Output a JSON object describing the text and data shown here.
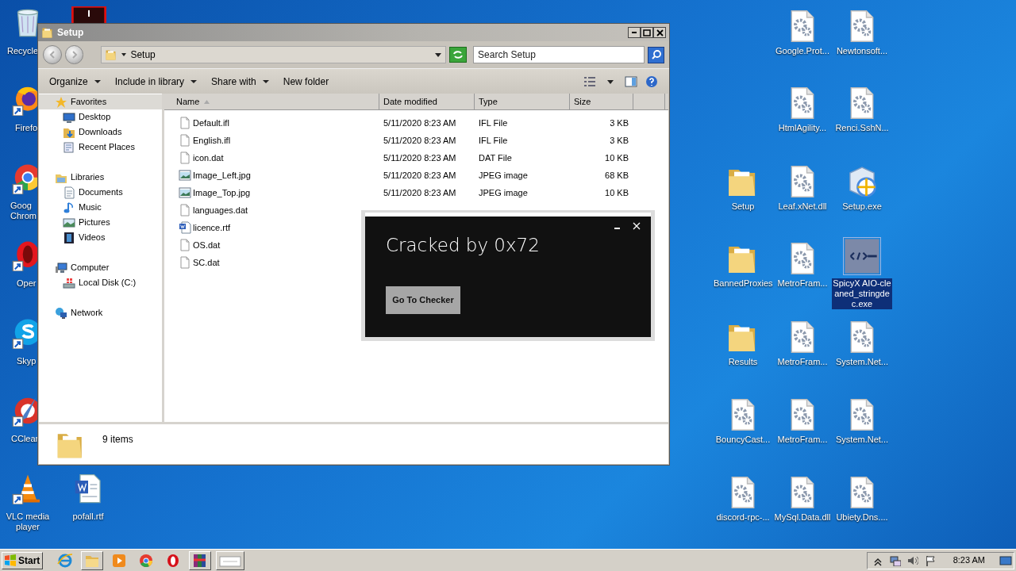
{
  "desktop_left": [
    {
      "kind": "recycle",
      "label": "Recycle"
    },
    {
      "kind": "redapp"
    },
    {
      "kind": "firefox",
      "label": "Firefo"
    },
    {
      "kind": "chrome",
      "label": "Goog Chrom"
    },
    {
      "kind": "opera",
      "label": "Oper"
    },
    {
      "kind": "skype",
      "label": "Skyp"
    },
    {
      "kind": "ccleaner",
      "label": "CClear"
    },
    {
      "kind": "vlc",
      "label": "VLC media player"
    },
    {
      "kind": "word",
      "label": "pofall.rtf"
    }
  ],
  "explorer": {
    "title": "Setup",
    "address": "Setup",
    "search": {
      "placeholder": "Search Setup"
    },
    "toolbar": [
      {
        "label": "Organize",
        "dropdown": true
      },
      {
        "label": "Include in library",
        "dropdown": true
      },
      {
        "label": "Share with",
        "dropdown": true
      },
      {
        "label": "New folder",
        "dropdown": false
      }
    ],
    "navigation": [
      {
        "label": "Favorites",
        "kind": "star",
        "selected": true,
        "children": [
          {
            "label": "Desktop",
            "kind": "desktop",
            "selected": false
          },
          {
            "label": "Downloads",
            "kind": "downloads",
            "selected": false
          },
          {
            "label": "Recent Places",
            "kind": "recent",
            "selected": false
          }
        ]
      },
      {
        "label": "Libraries",
        "kind": "library",
        "selected": false,
        "children": [
          {
            "label": "Documents",
            "kind": "document",
            "selected": false
          },
          {
            "label": "Music",
            "kind": "music",
            "selected": false
          },
          {
            "label": "Pictures",
            "kind": "pictures",
            "selected": false
          },
          {
            "label": "Videos",
            "kind": "videos",
            "selected": false
          }
        ]
      },
      {
        "label": "Computer",
        "kind": "computer",
        "selected": false,
        "children": [
          {
            "label": "Local Disk (C:)",
            "kind": "disk",
            "selected": false
          }
        ]
      },
      {
        "label": "Network",
        "kind": "network",
        "selected": false
      }
    ],
    "columns": [
      {
        "label": "Name",
        "sorted": true
      },
      {
        "label": "Date modified",
        "sorted": false
      },
      {
        "label": "Type",
        "sorted": false
      },
      {
        "label": "Size",
        "sorted": false
      }
    ],
    "files": [
      {
        "name": "Default.ifl",
        "kind": "blank",
        "date": "5/11/2020 8:23 AM",
        "type": "IFL File",
        "size": "3 KB"
      },
      {
        "name": "English.ifl",
        "kind": "blank",
        "date": "5/11/2020 8:23 AM",
        "type": "IFL File",
        "size": "3 KB"
      },
      {
        "name": "icon.dat",
        "kind": "blank",
        "date": "5/11/2020 8:23 AM",
        "type": "DAT File",
        "size": "10 KB"
      },
      {
        "name": "Image_Left.jpg",
        "kind": "image",
        "date": "5/11/2020 8:23 AM",
        "type": "JPEG image",
        "size": "68 KB"
      },
      {
        "name": "Image_Top.jpg",
        "kind": "image",
        "date": "5/11/2020 8:23 AM",
        "type": "JPEG image",
        "size": "10 KB"
      },
      {
        "name": "languages.dat",
        "kind": "blank"
      },
      {
        "name": "licence.rtf",
        "kind": "word"
      },
      {
        "name": "OS.dat",
        "kind": "blank"
      },
      {
        "name": "SC.dat",
        "kind": "blank"
      }
    ],
    "status": "9 items"
  },
  "dialog": {
    "title": "Cracked by 0x72",
    "button": "Go To Checker"
  },
  "desktop_right": [
    {
      "kind": "gearfile",
      "label": "Google.Prot...",
      "selected": false
    },
    {
      "kind": "gearfile",
      "label": "Newtonsoft...",
      "selected": false
    },
    {
      "kind": "gearfile",
      "label": "HtmlAgility...",
      "selected": false
    },
    {
      "kind": "gearfile",
      "label": "Renci.SshN...",
      "selected": false
    },
    {
      "kind": "folder",
      "label": "Setup",
      "selected": false
    },
    {
      "kind": "gearfile",
      "label": "Leaf.xNet.dll",
      "selected": false
    },
    {
      "kind": "installer",
      "label": "Setup.exe",
      "selected": false
    },
    {
      "kind": "folder",
      "label": "BannedProxies",
      "selected": false
    },
    {
      "kind": "gearfile",
      "label": "MetroFram...",
      "selected": false
    },
    {
      "kind": "program",
      "label": "SpicyX AIO-cleaned_stringdec.exe",
      "selected": true
    },
    {
      "kind": "folder",
      "label": "Results",
      "selected": false
    },
    {
      "kind": "gearfile",
      "label": "MetroFram...",
      "selected": false
    },
    {
      "kind": "gearfile",
      "label": "System.Net...",
      "selected": false
    },
    {
      "kind": "gearfile",
      "label": "BouncyCast...",
      "selected": false
    },
    {
      "kind": "gearfile",
      "label": "MetroFram...",
      "selected": false
    },
    {
      "kind": "gearfile",
      "label": "System.Net...",
      "selected": false
    },
    {
      "kind": "gearfile",
      "label": "discord-rpc-...",
      "selected": false
    },
    {
      "kind": "gearfile",
      "label": "MySql.Data.dll",
      "selected": false
    },
    {
      "kind": "gearfile",
      "label": "Ubiety.Dns....",
      "selected": false
    }
  ],
  "taskbar": {
    "start": "Start",
    "items": [
      {
        "kind": "ie"
      },
      {
        "kind": "explorer"
      },
      {
        "kind": "media"
      },
      {
        "kind": "chrome"
      },
      {
        "kind": "opera"
      },
      {
        "kind": "winrar"
      },
      {
        "kind": "window"
      }
    ],
    "clock": "8:23 AM"
  }
}
